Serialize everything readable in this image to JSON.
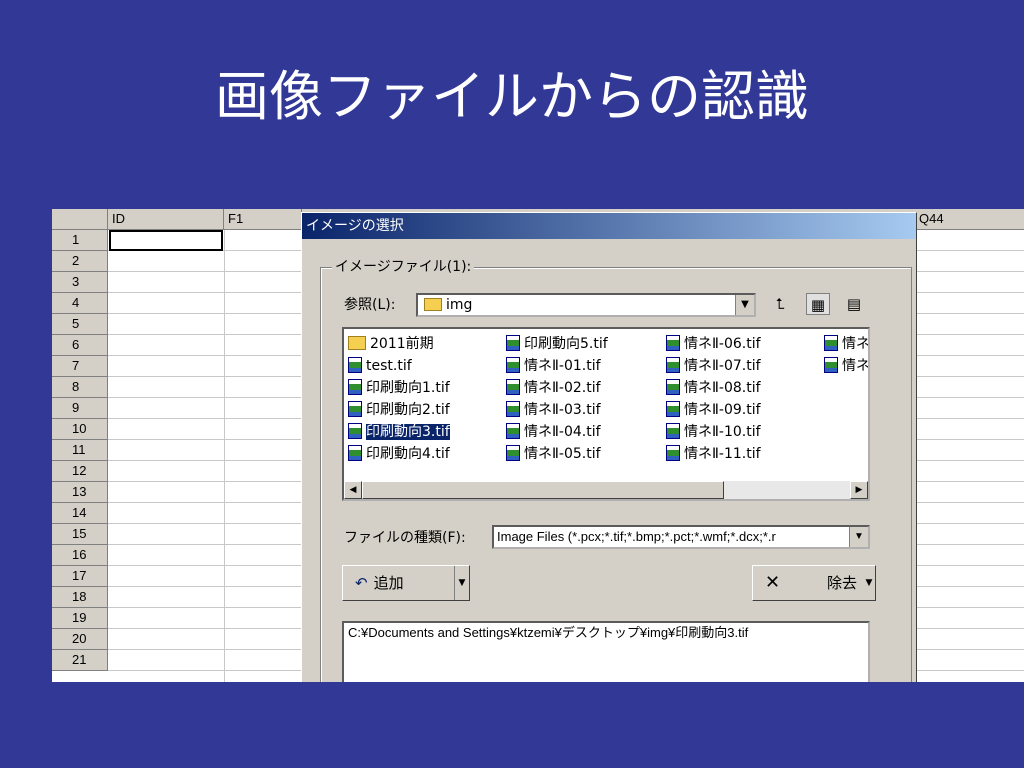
{
  "slide": {
    "title": "画像ファイルからの認識"
  },
  "sheet": {
    "columns": [
      "ID",
      "F1",
      "Q44"
    ],
    "rows": [
      "1",
      "2",
      "3",
      "4",
      "5",
      "6",
      "7",
      "8",
      "9",
      "10",
      "11",
      "12",
      "13",
      "14",
      "15",
      "16",
      "17",
      "18",
      "19",
      "20",
      "21"
    ]
  },
  "dialog": {
    "title": "イメージの選択",
    "group_label": "イメージファイル(1):",
    "lookin_label": "参照(L):",
    "lookin_value": "img",
    "files": [
      {
        "name": "2011前期",
        "kind": "folder",
        "selected": false
      },
      {
        "name": "test.tif",
        "kind": "image",
        "selected": false
      },
      {
        "name": "印刷動向1.tif",
        "kind": "image",
        "selected": false
      },
      {
        "name": "印刷動向2.tif",
        "kind": "image",
        "selected": false
      },
      {
        "name": "印刷動向3.tif",
        "kind": "image",
        "selected": true
      },
      {
        "name": "印刷動向4.tif",
        "kind": "image",
        "selected": false
      },
      {
        "name": "印刷動向5.tif",
        "kind": "image",
        "selected": false
      },
      {
        "name": "情ネⅡ-01.tif",
        "kind": "image",
        "selected": false
      },
      {
        "name": "情ネⅡ-02.tif",
        "kind": "image",
        "selected": false
      },
      {
        "name": "情ネⅡ-03.tif",
        "kind": "image",
        "selected": false
      },
      {
        "name": "情ネⅡ-04.tif",
        "kind": "image",
        "selected": false
      },
      {
        "name": "情ネⅡ-05.tif",
        "kind": "image",
        "selected": false
      },
      {
        "name": "情ネⅡ-06.tif",
        "kind": "image",
        "selected": false
      },
      {
        "name": "情ネⅡ-07.tif",
        "kind": "image",
        "selected": false
      },
      {
        "name": "情ネⅡ-08.tif",
        "kind": "image",
        "selected": false
      },
      {
        "name": "情ネⅡ-09.tif",
        "kind": "image",
        "selected": false
      },
      {
        "name": "情ネⅡ-10.tif",
        "kind": "image",
        "selected": false
      },
      {
        "name": "情ネⅡ-11.tif",
        "kind": "image",
        "selected": false
      },
      {
        "name": "情ネ",
        "kind": "image",
        "selected": false
      },
      {
        "name": "情ネ",
        "kind": "image",
        "selected": false
      }
    ],
    "filetype_label": "ファイルの種類(F):",
    "filetype_value": "Image Files (*.pcx;*.tif;*.bmp;*.pct;*.wmf;*.dcx;*.r",
    "add_label": "追加",
    "remove_label": "除去",
    "path_value": "C:¥Documents and Settings¥ktzemi¥デスクトップ¥img¥印刷動向3.tif"
  }
}
